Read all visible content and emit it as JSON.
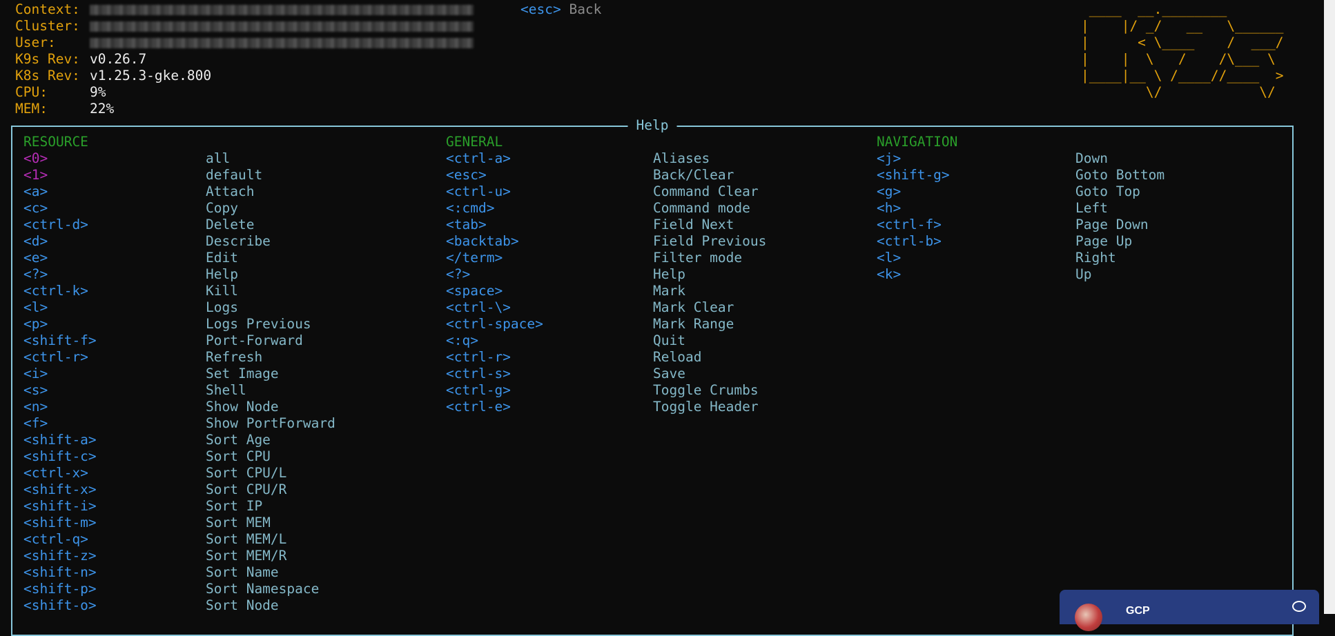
{
  "info": [
    {
      "label": "Context:",
      "value": "",
      "redacted": true
    },
    {
      "label": "Cluster:",
      "value": "",
      "redacted": true
    },
    {
      "label": "User:",
      "value": "",
      "redacted": true
    },
    {
      "label": "K9s Rev:",
      "value": "v0.26.7"
    },
    {
      "label": "K8s Rev:",
      "value": "v1.25.3-gke.800"
    },
    {
      "label": "CPU:",
      "value": "9%"
    },
    {
      "label": "MEM:",
      "value": "22%"
    }
  ],
  "esc_hint": {
    "key": "<esc>",
    "label": "Back"
  },
  "logo": " ____  __.________\n|    |/ _/   __   \\______\n|      < \\____    /  ___/\n|    |  \\   /    /\\___ \\\n|____|__ \\ /____//____  >\n        \\/            \\/",
  "help": {
    "title": "Help",
    "columns": [
      {
        "heading": "RESOURCE",
        "items": [
          {
            "key": "<0>",
            "desc": "all",
            "highlight": true
          },
          {
            "key": "<1>",
            "desc": "default",
            "highlight": true
          },
          {
            "key": "<a>",
            "desc": "Attach"
          },
          {
            "key": "<c>",
            "desc": "Copy"
          },
          {
            "key": "<ctrl-d>",
            "desc": "Delete"
          },
          {
            "key": "<d>",
            "desc": "Describe"
          },
          {
            "key": "<e>",
            "desc": "Edit"
          },
          {
            "key": "<?>",
            "desc": "Help"
          },
          {
            "key": "<ctrl-k>",
            "desc": "Kill"
          },
          {
            "key": "<l>",
            "desc": "Logs"
          },
          {
            "key": "<p>",
            "desc": "Logs Previous"
          },
          {
            "key": "<shift-f>",
            "desc": "Port-Forward"
          },
          {
            "key": "<ctrl-r>",
            "desc": "Refresh"
          },
          {
            "key": "<i>",
            "desc": "Set Image"
          },
          {
            "key": "<s>",
            "desc": "Shell"
          },
          {
            "key": "<n>",
            "desc": "Show Node"
          },
          {
            "key": "<f>",
            "desc": "Show PortForward"
          },
          {
            "key": "<shift-a>",
            "desc": "Sort Age"
          },
          {
            "key": "<shift-c>",
            "desc": "Sort CPU"
          },
          {
            "key": "<ctrl-x>",
            "desc": "Sort CPU/L"
          },
          {
            "key": "<shift-x>",
            "desc": "Sort CPU/R"
          },
          {
            "key": "<shift-i>",
            "desc": "Sort IP"
          },
          {
            "key": "<shift-m>",
            "desc": "Sort MEM"
          },
          {
            "key": "<ctrl-q>",
            "desc": "Sort MEM/L"
          },
          {
            "key": "<shift-z>",
            "desc": "Sort MEM/R"
          },
          {
            "key": "<shift-n>",
            "desc": "Sort Name"
          },
          {
            "key": "<shift-p>",
            "desc": "Sort Namespace"
          },
          {
            "key": "<shift-o>",
            "desc": "Sort Node"
          }
        ]
      },
      {
        "heading": "GENERAL",
        "items": [
          {
            "key": "<ctrl-a>",
            "desc": "Aliases"
          },
          {
            "key": "<esc>",
            "desc": "Back/Clear"
          },
          {
            "key": "<ctrl-u>",
            "desc": "Command Clear"
          },
          {
            "key": "<:cmd>",
            "desc": "Command mode"
          },
          {
            "key": "<tab>",
            "desc": "Field Next"
          },
          {
            "key": "<backtab>",
            "desc": "Field Previous"
          },
          {
            "key": "</term>",
            "desc": "Filter mode"
          },
          {
            "key": "<?>",
            "desc": "Help"
          },
          {
            "key": "<space>",
            "desc": "Mark"
          },
          {
            "key": "<ctrl-\\>",
            "desc": "Mark Clear"
          },
          {
            "key": "<ctrl-space>",
            "desc": "Mark Range"
          },
          {
            "key": "<:q>",
            "desc": "Quit"
          },
          {
            "key": "<ctrl-r>",
            "desc": "Reload"
          },
          {
            "key": "<ctrl-s>",
            "desc": "Save"
          },
          {
            "key": "<ctrl-g>",
            "desc": "Toggle Crumbs"
          },
          {
            "key": "<ctrl-e>",
            "desc": "Toggle Header"
          }
        ]
      },
      {
        "heading": "NAVIGATION",
        "items": [
          {
            "key": "<j>",
            "desc": "Down"
          },
          {
            "key": "<shift-g>",
            "desc": "Goto Bottom"
          },
          {
            "key": "<g>",
            "desc": "Goto Top"
          },
          {
            "key": "<h>",
            "desc": "Left"
          },
          {
            "key": "<ctrl-f>",
            "desc": "Page Down"
          },
          {
            "key": "<ctrl-b>",
            "desc": "Page Up"
          },
          {
            "key": "<l>",
            "desc": "Right"
          },
          {
            "key": "<k>",
            "desc": "Up"
          }
        ]
      }
    ]
  },
  "chat_popup": {
    "name": "GCP"
  },
  "colors": {
    "label": "#e2a10c",
    "key": "#3d94ea",
    "key_highlight": "#b62db6",
    "heading": "#2a9f2a",
    "desc": "#84b8c8",
    "frame": "#88c7da",
    "background": "#0c0c0c"
  }
}
